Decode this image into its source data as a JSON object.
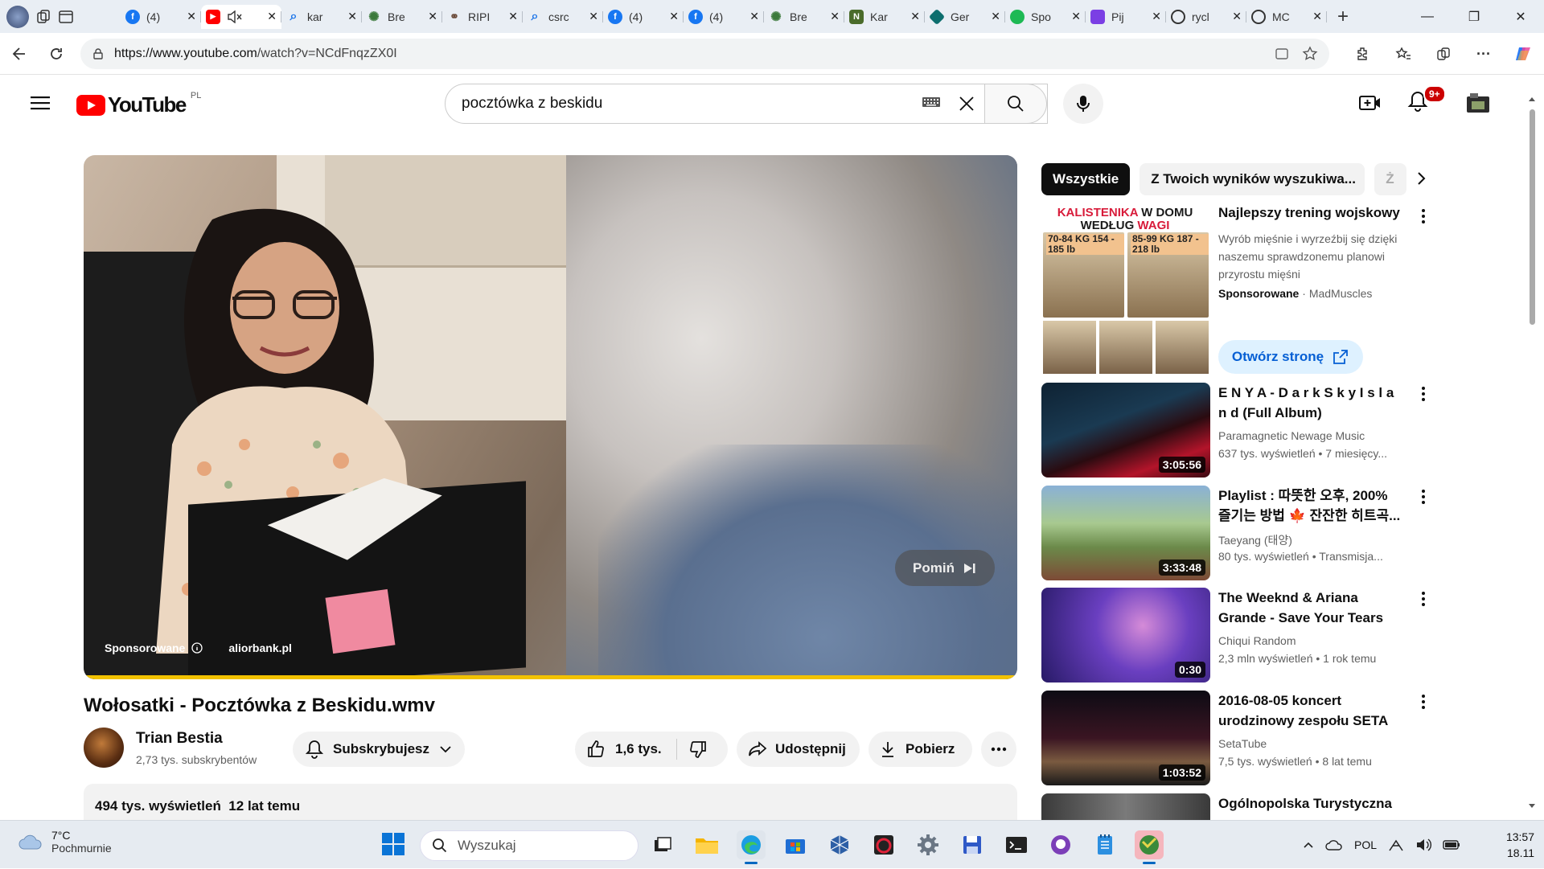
{
  "browser": {
    "tabs": [
      {
        "label": "(4)",
        "icon": "facebook-icon",
        "color": "#1877f2"
      },
      {
        "label": "",
        "icon": "youtube-icon",
        "color": "#ff0000",
        "active": true
      },
      {
        "label": "kar",
        "icon": "search-icon",
        "color": "#1a73e8"
      },
      {
        "label": "Bre",
        "icon": "gear-green-icon",
        "color": "#3c7a3c"
      },
      {
        "label": "RIPI",
        "icon": "link-icon",
        "color": "#6b4b3a"
      },
      {
        "label": "csrc",
        "icon": "search-icon",
        "color": "#1a73e8"
      },
      {
        "label": "(4)",
        "icon": "facebook-icon",
        "color": "#1877f2"
      },
      {
        "label": "(4)",
        "icon": "facebook-icon",
        "color": "#1877f2"
      },
      {
        "label": "Bre",
        "icon": "gear-green-icon",
        "color": "#3c7a3c"
      },
      {
        "label": "Kar",
        "icon": "n-icon",
        "color": "#4a6b2a"
      },
      {
        "label": "Ger",
        "icon": "diamond-icon",
        "color": "#0d6e6e"
      },
      {
        "label": "Spo",
        "icon": "spotify-icon",
        "color": "#1db954"
      },
      {
        "label": "Pij",
        "icon": "puzzle-icon",
        "color": "#7b3fe4"
      },
      {
        "label": "rycl",
        "icon": "github-icon",
        "color": "#333333"
      },
      {
        "label": "MC",
        "icon": "github-icon",
        "color": "#333333"
      }
    ],
    "new_tab": "+",
    "url_host": "https://www.youtube.com",
    "url_path": "/watch?v=NCdFnqzZX0I"
  },
  "youtube": {
    "logo_text": "YouTube",
    "country_code": "PL",
    "search_value": "pocztówka z beskidu",
    "notif_badge": "9+"
  },
  "player": {
    "skip_label": "Pomiń",
    "sponsored_label": "Sponsorowane",
    "advertiser": "aliorbank.pl"
  },
  "video": {
    "title": "Wołosatki - Pocztówka z Beskidu.wmv",
    "channel": "Trian Bestia",
    "subscribers": "2,73 tys. subskrybentów",
    "subscribe_label": "Subskrybujesz",
    "likes": "1,6 tys.",
    "share_label": "Udostępnij",
    "download_label": "Pobierz",
    "views_date": "494 tys. wyświetleń  12 lat temu"
  },
  "chips": [
    "Wszystkie",
    "Z Twoich wyników wyszukiwa...",
    "Ż"
  ],
  "ad": {
    "thumb_title_red": "KALISTENIKA",
    "thumb_title_dark": "W DOMU WEDŁUG",
    "thumb_title_red2": "WAGI",
    "weights": [
      "70-84 KG 154 - 185 lb",
      "85-99 KG 187 - 218 lb"
    ],
    "title": "Najlepszy trening wojskowy",
    "desc": "Wyrób mięśnie i wyrzeźbij się dzięki naszemu sprawdzonemu planowi przyrostu mięśni",
    "sponsored": "Sponsorowane",
    "advertiser": "MadMuscles",
    "cta": "Otwórz stronę"
  },
  "recommendations": [
    {
      "title": "E N Y A - D a r k S k y I s l a n d (Full Album)",
      "channel": "Paramagnetic Newage Music",
      "meta": "637 tys. wyświetleń  • 7 miesięcy...",
      "duration": "3:05:56"
    },
    {
      "title": "Playlist : 따뜻한 오후, 200% 즐기는 방법 🍁 잔잔한 히트곡...",
      "channel": "Taeyang (태양)",
      "meta": "80 tys. wyświetleń  • Transmisja...",
      "duration": "3:33:48"
    },
    {
      "title": "The Weeknd & Ariana Grande - Save Your Tears (Ariana whistl...",
      "channel": "Chiqui Random",
      "meta": "2,3 mln wyświetleń  • 1 rok temu",
      "duration": "0:30"
    },
    {
      "title": "2016-08-05 koncert urodzinowy zespołu SETA",
      "channel": "SetaTube",
      "meta": "7,5 tys. wyświetleń  • 8 lat temu",
      "duration": "1:03:52"
    },
    {
      "title": "Ogólnopolska Turystyczna",
      "channel": "",
      "meta": "",
      "duration": ""
    }
  ],
  "taskbar": {
    "temp": "7°C",
    "weather": "Pochmurnie",
    "search_placeholder": "Wyszukaj",
    "lang": "POL",
    "time": "13:57",
    "date": "18.11"
  }
}
